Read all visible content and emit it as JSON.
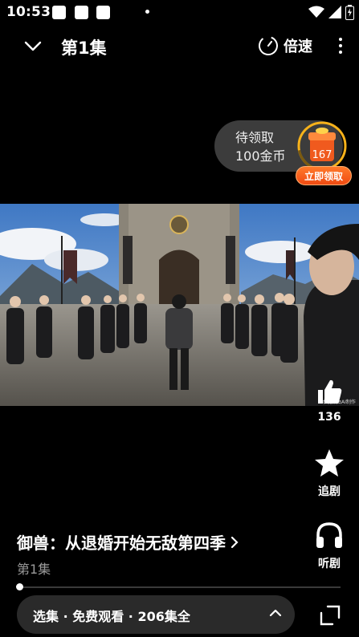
{
  "status_bar": {
    "time": "10:53",
    "icons": [
      "wifi-icon",
      "signal-icon",
      "battery-icon"
    ]
  },
  "top_bar": {
    "episode_title": "第1集",
    "speed_label": "倍速"
  },
  "reward": {
    "line1": "待领取",
    "line2": "100金币",
    "count": "167",
    "claim_label": "立即领取"
  },
  "video": {
    "watermark": "本视频由AI制作"
  },
  "side_actions": {
    "like_count": "136",
    "follow_label": "追剧",
    "listen_label": "听剧"
  },
  "drama": {
    "title": "御兽：从退婚开始无敌第四季",
    "episode": "第1集"
  },
  "episode_bar": {
    "text": "选集 · 免费观看 · 206集全"
  },
  "colors": {
    "background": "#000000",
    "accent": "#f05a1e",
    "pill": "#2a2a2a"
  }
}
